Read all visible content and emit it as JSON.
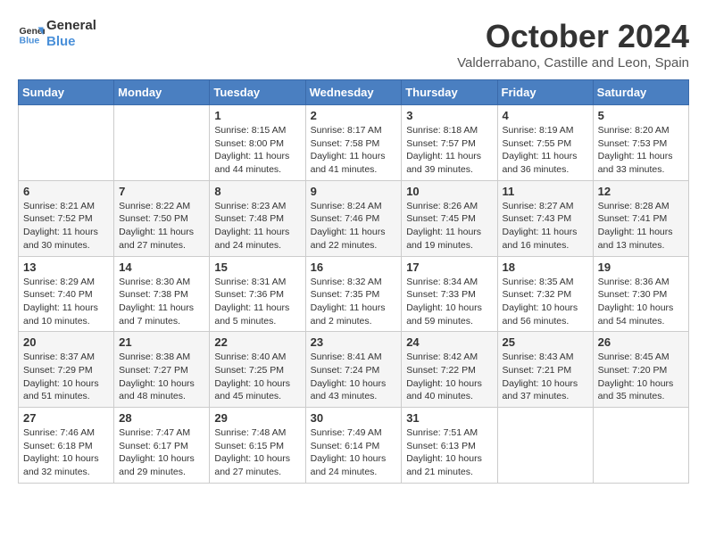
{
  "header": {
    "logo_line1": "General",
    "logo_line2": "Blue",
    "month_year": "October 2024",
    "location": "Valderrabano, Castille and Leon, Spain"
  },
  "weekdays": [
    "Sunday",
    "Monday",
    "Tuesday",
    "Wednesday",
    "Thursday",
    "Friday",
    "Saturday"
  ],
  "weeks": [
    [
      {
        "day": "",
        "info": ""
      },
      {
        "day": "",
        "info": ""
      },
      {
        "day": "1",
        "info": "Sunrise: 8:15 AM\nSunset: 8:00 PM\nDaylight: 11 hours and 44 minutes."
      },
      {
        "day": "2",
        "info": "Sunrise: 8:17 AM\nSunset: 7:58 PM\nDaylight: 11 hours and 41 minutes."
      },
      {
        "day": "3",
        "info": "Sunrise: 8:18 AM\nSunset: 7:57 PM\nDaylight: 11 hours and 39 minutes."
      },
      {
        "day": "4",
        "info": "Sunrise: 8:19 AM\nSunset: 7:55 PM\nDaylight: 11 hours and 36 minutes."
      },
      {
        "day": "5",
        "info": "Sunrise: 8:20 AM\nSunset: 7:53 PM\nDaylight: 11 hours and 33 minutes."
      }
    ],
    [
      {
        "day": "6",
        "info": "Sunrise: 8:21 AM\nSunset: 7:52 PM\nDaylight: 11 hours and 30 minutes."
      },
      {
        "day": "7",
        "info": "Sunrise: 8:22 AM\nSunset: 7:50 PM\nDaylight: 11 hours and 27 minutes."
      },
      {
        "day": "8",
        "info": "Sunrise: 8:23 AM\nSunset: 7:48 PM\nDaylight: 11 hours and 24 minutes."
      },
      {
        "day": "9",
        "info": "Sunrise: 8:24 AM\nSunset: 7:46 PM\nDaylight: 11 hours and 22 minutes."
      },
      {
        "day": "10",
        "info": "Sunrise: 8:26 AM\nSunset: 7:45 PM\nDaylight: 11 hours and 19 minutes."
      },
      {
        "day": "11",
        "info": "Sunrise: 8:27 AM\nSunset: 7:43 PM\nDaylight: 11 hours and 16 minutes."
      },
      {
        "day": "12",
        "info": "Sunrise: 8:28 AM\nSunset: 7:41 PM\nDaylight: 11 hours and 13 minutes."
      }
    ],
    [
      {
        "day": "13",
        "info": "Sunrise: 8:29 AM\nSunset: 7:40 PM\nDaylight: 11 hours and 10 minutes."
      },
      {
        "day": "14",
        "info": "Sunrise: 8:30 AM\nSunset: 7:38 PM\nDaylight: 11 hours and 7 minutes."
      },
      {
        "day": "15",
        "info": "Sunrise: 8:31 AM\nSunset: 7:36 PM\nDaylight: 11 hours and 5 minutes."
      },
      {
        "day": "16",
        "info": "Sunrise: 8:32 AM\nSunset: 7:35 PM\nDaylight: 11 hours and 2 minutes."
      },
      {
        "day": "17",
        "info": "Sunrise: 8:34 AM\nSunset: 7:33 PM\nDaylight: 10 hours and 59 minutes."
      },
      {
        "day": "18",
        "info": "Sunrise: 8:35 AM\nSunset: 7:32 PM\nDaylight: 10 hours and 56 minutes."
      },
      {
        "day": "19",
        "info": "Sunrise: 8:36 AM\nSunset: 7:30 PM\nDaylight: 10 hours and 54 minutes."
      }
    ],
    [
      {
        "day": "20",
        "info": "Sunrise: 8:37 AM\nSunset: 7:29 PM\nDaylight: 10 hours and 51 minutes."
      },
      {
        "day": "21",
        "info": "Sunrise: 8:38 AM\nSunset: 7:27 PM\nDaylight: 10 hours and 48 minutes."
      },
      {
        "day": "22",
        "info": "Sunrise: 8:40 AM\nSunset: 7:25 PM\nDaylight: 10 hours and 45 minutes."
      },
      {
        "day": "23",
        "info": "Sunrise: 8:41 AM\nSunset: 7:24 PM\nDaylight: 10 hours and 43 minutes."
      },
      {
        "day": "24",
        "info": "Sunrise: 8:42 AM\nSunset: 7:22 PM\nDaylight: 10 hours and 40 minutes."
      },
      {
        "day": "25",
        "info": "Sunrise: 8:43 AM\nSunset: 7:21 PM\nDaylight: 10 hours and 37 minutes."
      },
      {
        "day": "26",
        "info": "Sunrise: 8:45 AM\nSunset: 7:20 PM\nDaylight: 10 hours and 35 minutes."
      }
    ],
    [
      {
        "day": "27",
        "info": "Sunrise: 7:46 AM\nSunset: 6:18 PM\nDaylight: 10 hours and 32 minutes."
      },
      {
        "day": "28",
        "info": "Sunrise: 7:47 AM\nSunset: 6:17 PM\nDaylight: 10 hours and 29 minutes."
      },
      {
        "day": "29",
        "info": "Sunrise: 7:48 AM\nSunset: 6:15 PM\nDaylight: 10 hours and 27 minutes."
      },
      {
        "day": "30",
        "info": "Sunrise: 7:49 AM\nSunset: 6:14 PM\nDaylight: 10 hours and 24 minutes."
      },
      {
        "day": "31",
        "info": "Sunrise: 7:51 AM\nSunset: 6:13 PM\nDaylight: 10 hours and 21 minutes."
      },
      {
        "day": "",
        "info": ""
      },
      {
        "day": "",
        "info": ""
      }
    ]
  ]
}
